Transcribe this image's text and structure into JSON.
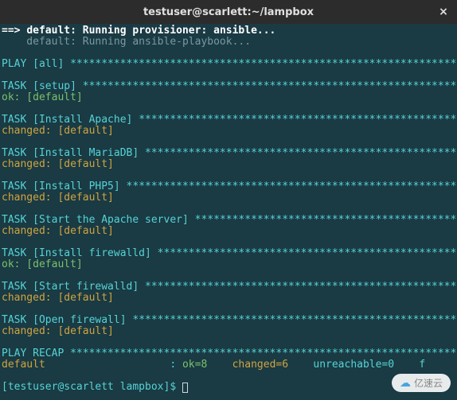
{
  "window": {
    "title": "testuser@scarlett:~/lampbox",
    "close": "×"
  },
  "lines": [
    {
      "segments": [
        {
          "text": "==> ",
          "cls": "bold white"
        },
        {
          "text": "default: Running provisioner: ansible...",
          "cls": "bold white"
        }
      ]
    },
    {
      "segments": [
        {
          "text": "    default: Running ansible-playbook...",
          "cls": "gray"
        }
      ]
    },
    {
      "segments": [
        {
          "text": " ",
          "cls": ""
        }
      ]
    },
    {
      "segments": [
        {
          "text": "PLAY [all] ",
          "cls": "cyan"
        },
        {
          "text": "********************************************************************",
          "cls": "cyan"
        }
      ]
    },
    {
      "segments": [
        {
          "text": " ",
          "cls": ""
        }
      ]
    },
    {
      "segments": [
        {
          "text": "TASK [setup] ",
          "cls": "cyan"
        },
        {
          "text": "*******************************************************************",
          "cls": "cyan"
        }
      ]
    },
    {
      "segments": [
        {
          "text": "ok: [default]",
          "cls": "green"
        }
      ]
    },
    {
      "segments": [
        {
          "text": " ",
          "cls": ""
        }
      ]
    },
    {
      "segments": [
        {
          "text": "TASK [Install Apache] ",
          "cls": "cyan"
        },
        {
          "text": "**********************************************************",
          "cls": "cyan"
        }
      ]
    },
    {
      "segments": [
        {
          "text": "changed: [default]",
          "cls": "yellow"
        }
      ]
    },
    {
      "segments": [
        {
          "text": " ",
          "cls": ""
        }
      ]
    },
    {
      "segments": [
        {
          "text": "TASK [Install MariaDB] ",
          "cls": "cyan"
        },
        {
          "text": "*********************************************************",
          "cls": "cyan"
        }
      ]
    },
    {
      "segments": [
        {
          "text": "changed: [default]",
          "cls": "yellow"
        }
      ]
    },
    {
      "segments": [
        {
          "text": " ",
          "cls": ""
        }
      ]
    },
    {
      "segments": [
        {
          "text": "TASK [Install PHP5] ",
          "cls": "cyan"
        },
        {
          "text": "************************************************************",
          "cls": "cyan"
        }
      ]
    },
    {
      "segments": [
        {
          "text": "changed: [default]",
          "cls": "yellow"
        }
      ]
    },
    {
      "segments": [
        {
          "text": " ",
          "cls": ""
        }
      ]
    },
    {
      "segments": [
        {
          "text": "TASK [Start the Apache server] ",
          "cls": "cyan"
        },
        {
          "text": "*************************************************",
          "cls": "cyan"
        }
      ]
    },
    {
      "segments": [
        {
          "text": "changed: [default]",
          "cls": "yellow"
        }
      ]
    },
    {
      "segments": [
        {
          "text": " ",
          "cls": ""
        }
      ]
    },
    {
      "segments": [
        {
          "text": "TASK [Install firewalld] ",
          "cls": "cyan"
        },
        {
          "text": "*******************************************************",
          "cls": "cyan"
        }
      ]
    },
    {
      "segments": [
        {
          "text": "ok: [default]",
          "cls": "green"
        }
      ]
    },
    {
      "segments": [
        {
          "text": " ",
          "cls": ""
        }
      ]
    },
    {
      "segments": [
        {
          "text": "TASK [Start firewalld] ",
          "cls": "cyan"
        },
        {
          "text": "*********************************************************",
          "cls": "cyan"
        }
      ]
    },
    {
      "segments": [
        {
          "text": "changed: [default]",
          "cls": "yellow"
        }
      ]
    },
    {
      "segments": [
        {
          "text": " ",
          "cls": ""
        }
      ]
    },
    {
      "segments": [
        {
          "text": "TASK [Open firewall] ",
          "cls": "cyan"
        },
        {
          "text": "***********************************************************",
          "cls": "cyan"
        }
      ]
    },
    {
      "segments": [
        {
          "text": "changed: [default]",
          "cls": "yellow"
        }
      ]
    },
    {
      "segments": [
        {
          "text": " ",
          "cls": ""
        }
      ]
    },
    {
      "segments": [
        {
          "text": "PLAY RECAP ",
          "cls": "cyan"
        },
        {
          "text": "*********************************************************************",
          "cls": "cyan"
        }
      ]
    },
    {
      "segments": [
        {
          "text": "default",
          "cls": "yellow"
        },
        {
          "text": "                    : ",
          "cls": "cyan"
        },
        {
          "text": "ok=8",
          "cls": "green"
        },
        {
          "text": "    ",
          "cls": ""
        },
        {
          "text": "changed=6",
          "cls": "yellow"
        },
        {
          "text": "    unreachable=0    f",
          "cls": "cyan"
        }
      ]
    },
    {
      "segments": [
        {
          "text": " ",
          "cls": ""
        }
      ]
    },
    {
      "segments": [
        {
          "text": "[testuser@scarlett lampbox]$ ",
          "cls": "cyan"
        }
      ],
      "cursor": true
    }
  ],
  "watermark": "亿速云"
}
